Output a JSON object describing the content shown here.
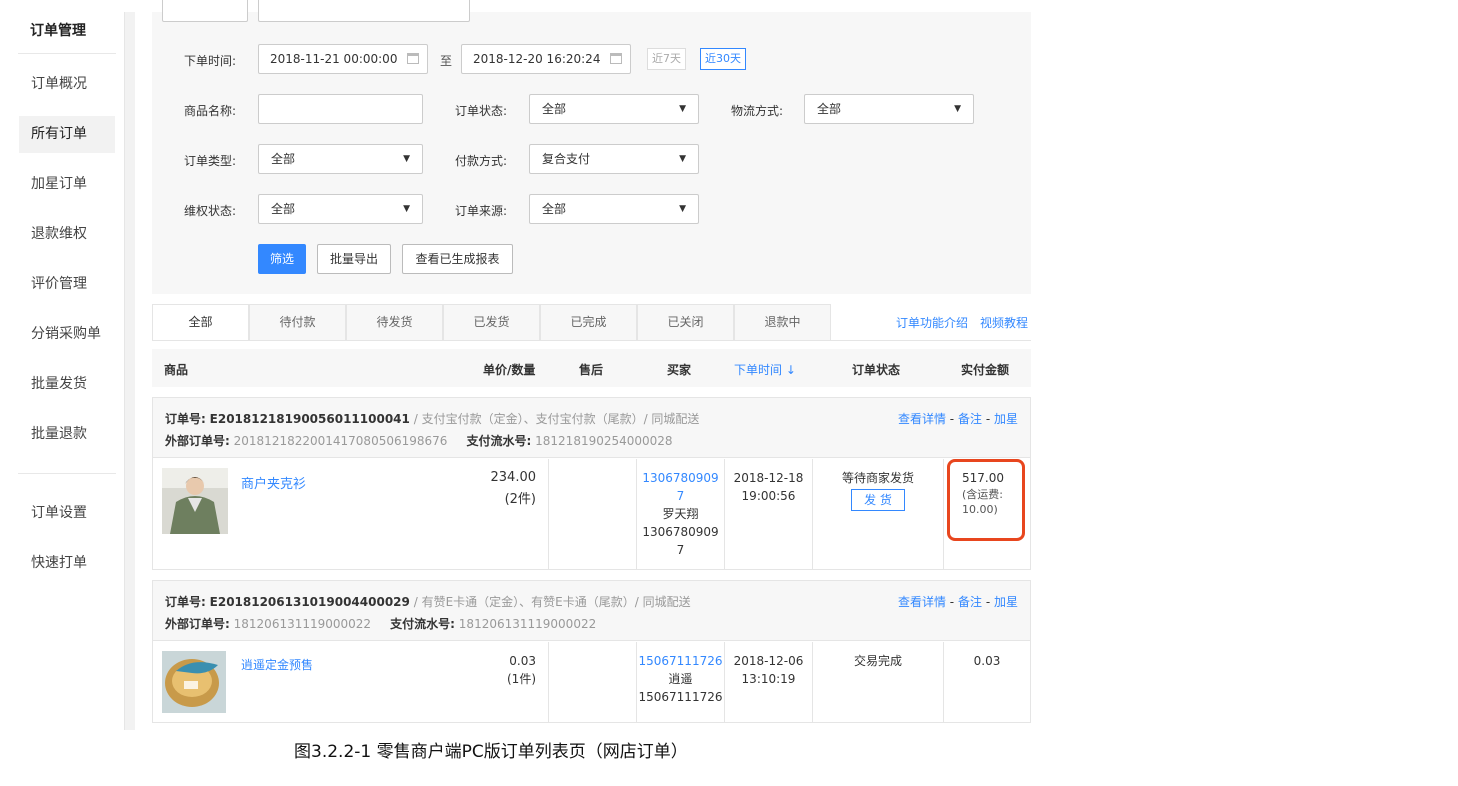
{
  "sidebar": {
    "title": "订单管理",
    "items": [
      {
        "label": "订单概况",
        "active": false
      },
      {
        "label": "所有订单",
        "active": true
      },
      {
        "label": "加星订单",
        "active": false
      },
      {
        "label": "退款维权",
        "active": false
      },
      {
        "label": "评价管理",
        "active": false
      },
      {
        "label": "分销采购单",
        "active": false
      },
      {
        "label": "批量发货",
        "active": false
      },
      {
        "label": "批量退款",
        "active": false
      }
    ],
    "items2": [
      {
        "label": "订单设置"
      },
      {
        "label": "快速打单"
      }
    ]
  },
  "filter": {
    "time_label": "下单时间:",
    "time_start": "2018-11-21 00:00:00",
    "time_to": "至",
    "time_end": "2018-12-20 16:20:24",
    "quick7": "近7天",
    "quick30": "近30天",
    "product_label": "商品名称:",
    "product_value": "",
    "status_label": "订单状态:",
    "status_value": "全部",
    "logistics_label": "物流方式:",
    "logistics_value": "全部",
    "type_label": "订单类型:",
    "type_value": "全部",
    "pay_label": "付款方式:",
    "pay_value": "复合支付",
    "rights_label": "维权状态:",
    "rights_value": "全部",
    "source_label": "订单来源:",
    "source_value": "全部",
    "btn_filter": "筛选",
    "btn_export": "批量导出",
    "btn_reports": "查看已生成报表"
  },
  "tabs": [
    "全部",
    "待付款",
    "待发货",
    "已发货",
    "已完成",
    "已关闭",
    "退款中"
  ],
  "links": {
    "intro": "订单功能介绍",
    "video": "视频教程"
  },
  "table_headers": {
    "product": "商品",
    "price_qty": "单价/数量",
    "aftersale": "售后",
    "buyer": "买家",
    "order_time": "下单时间 ↓",
    "status": "订单状态",
    "paid": "实付金额"
  },
  "orders": [
    {
      "no_label": "订单号:",
      "no": "E20181218190056011100041",
      "pay_desc": "/ 支付宝付款（定金）、支付宝付款（尾款）/ 同城配送",
      "ext_label": "外部订单号:",
      "ext_no": "2018121822001417080506198676",
      "flow_label": "支付流水号:",
      "flow_no": "181218190254000028",
      "op_detail": "查看详情",
      "op_note": "备注",
      "op_star": "加星",
      "op_sep": "-",
      "product": "商户夹克衫",
      "price": "234.00",
      "qty": "(2件)",
      "buyer_phone_a": "1306780909",
      "buyer_phone_b": "7",
      "buyer_name": "罗天翔",
      "buyer_phone2_a": "1306780909",
      "buyer_phone2_b": "7",
      "date": "2018-12-18",
      "time": "19:00:56",
      "status": "等待商家发货",
      "ship_btn": "发 货",
      "amount": "517.00",
      "freight_a": "(含运费:",
      "freight_b": "10.00)"
    },
    {
      "no_label": "订单号:",
      "no": "E20181206131019004400029",
      "pay_desc": "/ 有赞E卡通（定金）、有赞E卡通（尾款）/ 同城配送",
      "ext_label": "外部订单号:",
      "ext_no": "181206131119000022",
      "flow_label": "支付流水号:",
      "flow_no": "181206131119000022",
      "op_detail": "查看详情",
      "op_note": "备注",
      "op_star": "加星",
      "op_sep": "-",
      "product": "逍遥定金预售",
      "price": "0.03",
      "qty": "(1件)",
      "buyer_phone": "15067111726",
      "buyer_name": "逍遥",
      "buyer_phone2": "15067111726",
      "date": "2018-12-06",
      "time": "13:10:19",
      "status": "交易完成",
      "amount": "0.03"
    }
  ],
  "caption": "图3.2.2-1 零售商户端PC版订单列表页（网店订单）",
  "colors": {
    "accent": "#3388ff",
    "highlight": "#e8461e"
  }
}
